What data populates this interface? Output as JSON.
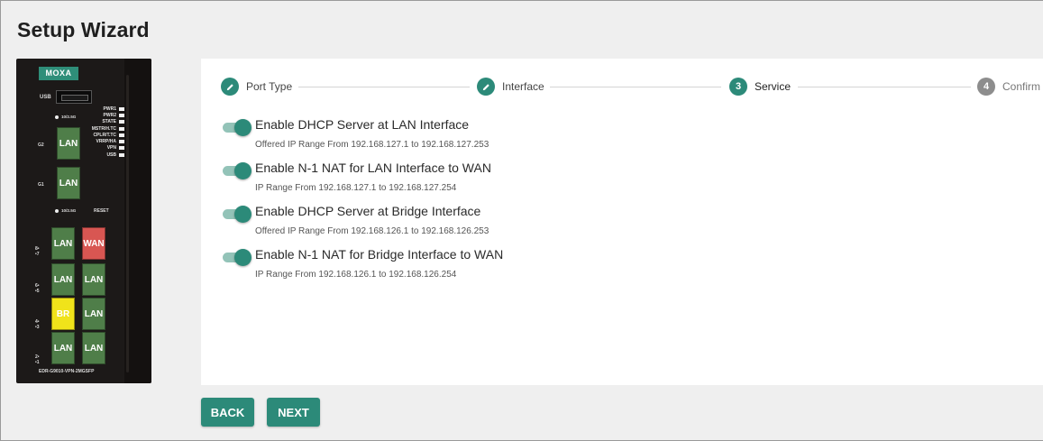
{
  "page": {
    "title": "Setup Wizard"
  },
  "device": {
    "brand": "MOXA",
    "usb_label": "USB",
    "leds": [
      "PWR1",
      "PWR2",
      "STATE",
      "MSTR/H.TC",
      "CPLR/T.TC",
      "VRRP/HA",
      "VPN",
      "USB"
    ],
    "speed_top": "10/2.5G",
    "speed_bottom": "10/2.5G",
    "reset_label": "RESET",
    "g2_label": "G2",
    "g1_label": "G1",
    "port_ids": [
      "8•\n•7",
      "6•\n•5",
      "4•\n•3",
      "2•\n•1"
    ],
    "ports": {
      "g2": "LAN",
      "g1": "LAN",
      "row1": [
        "LAN",
        "WAN"
      ],
      "row2": [
        "LAN",
        "LAN"
      ],
      "row3": [
        "BR",
        "LAN"
      ],
      "row4": [
        "LAN",
        "LAN"
      ]
    },
    "model": "EDR-G9010-VPN-2MGSFP"
  },
  "stepper": {
    "steps": [
      {
        "label": "Port Type",
        "state": "done",
        "number": ""
      },
      {
        "label": "Interface",
        "state": "done",
        "number": ""
      },
      {
        "label": "Service",
        "state": "active",
        "number": "3"
      },
      {
        "label": "Confirm",
        "state": "todo",
        "number": "4"
      }
    ]
  },
  "options": [
    {
      "title": "Enable DHCP Server at LAN Interface",
      "subtitle": "Offered IP Range From 192.168.127.1 to 192.168.127.253",
      "enabled": true
    },
    {
      "title": "Enable N-1 NAT for LAN Interface to WAN",
      "subtitle": "IP Range From 192.168.127.1 to 192.168.127.254",
      "enabled": true
    },
    {
      "title": "Enable DHCP Server at Bridge Interface",
      "subtitle": "Offered IP Range From 192.168.126.1 to 192.168.126.253",
      "enabled": true
    },
    {
      "title": "Enable N-1 NAT for Bridge Interface to WAN",
      "subtitle": "IP Range From 192.168.126.1 to 192.168.126.254",
      "enabled": true
    }
  ],
  "buttons": {
    "back": "BACK",
    "next": "NEXT"
  },
  "colors": {
    "accent": "#2c8a79",
    "toggle_track": "#93c3b8",
    "inactive_step": "#8d8d8d",
    "wan": "#d85652",
    "lan": "#4f7e49",
    "br": "#f0e31a"
  }
}
